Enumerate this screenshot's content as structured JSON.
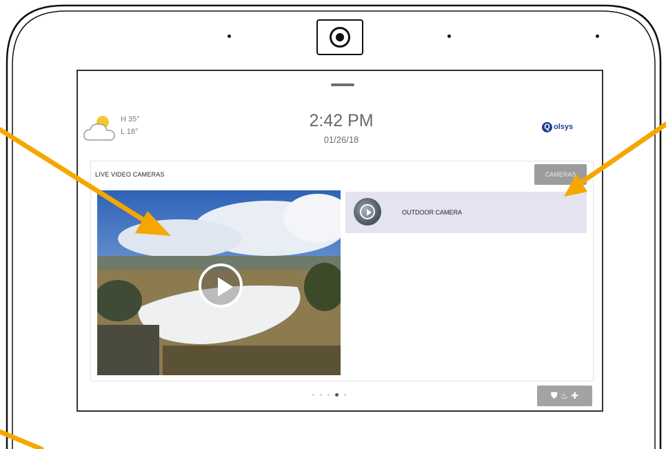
{
  "weather": {
    "icon": "partly-cloudy-icon",
    "high": "H 35°",
    "low": "L 18°"
  },
  "clock": {
    "time": "2:42 PM",
    "date": "01/26/18"
  },
  "brand": {
    "mark": "Q",
    "name": "olsys"
  },
  "cameras_card": {
    "title": "LIVE VIDEO CAMERAS",
    "cameras_button": "CAMERAS",
    "video_icon": "play-icon",
    "items": [
      {
        "label": "OUTDOOR CAMERA",
        "icon": "camera-thumbnail-play-icon",
        "selected": true
      }
    ]
  },
  "pager": {
    "pages": 5,
    "active_index": 3
  },
  "emergency": {
    "icons": [
      "police-shield-icon",
      "fire-icon",
      "medical-cross-icon"
    ]
  },
  "colors": {
    "accent_arrow": "#f5a700",
    "selected_row": "#e4e4f0",
    "button_gray": "#9c9c9c",
    "brand_blue": "#1d3f8e"
  }
}
